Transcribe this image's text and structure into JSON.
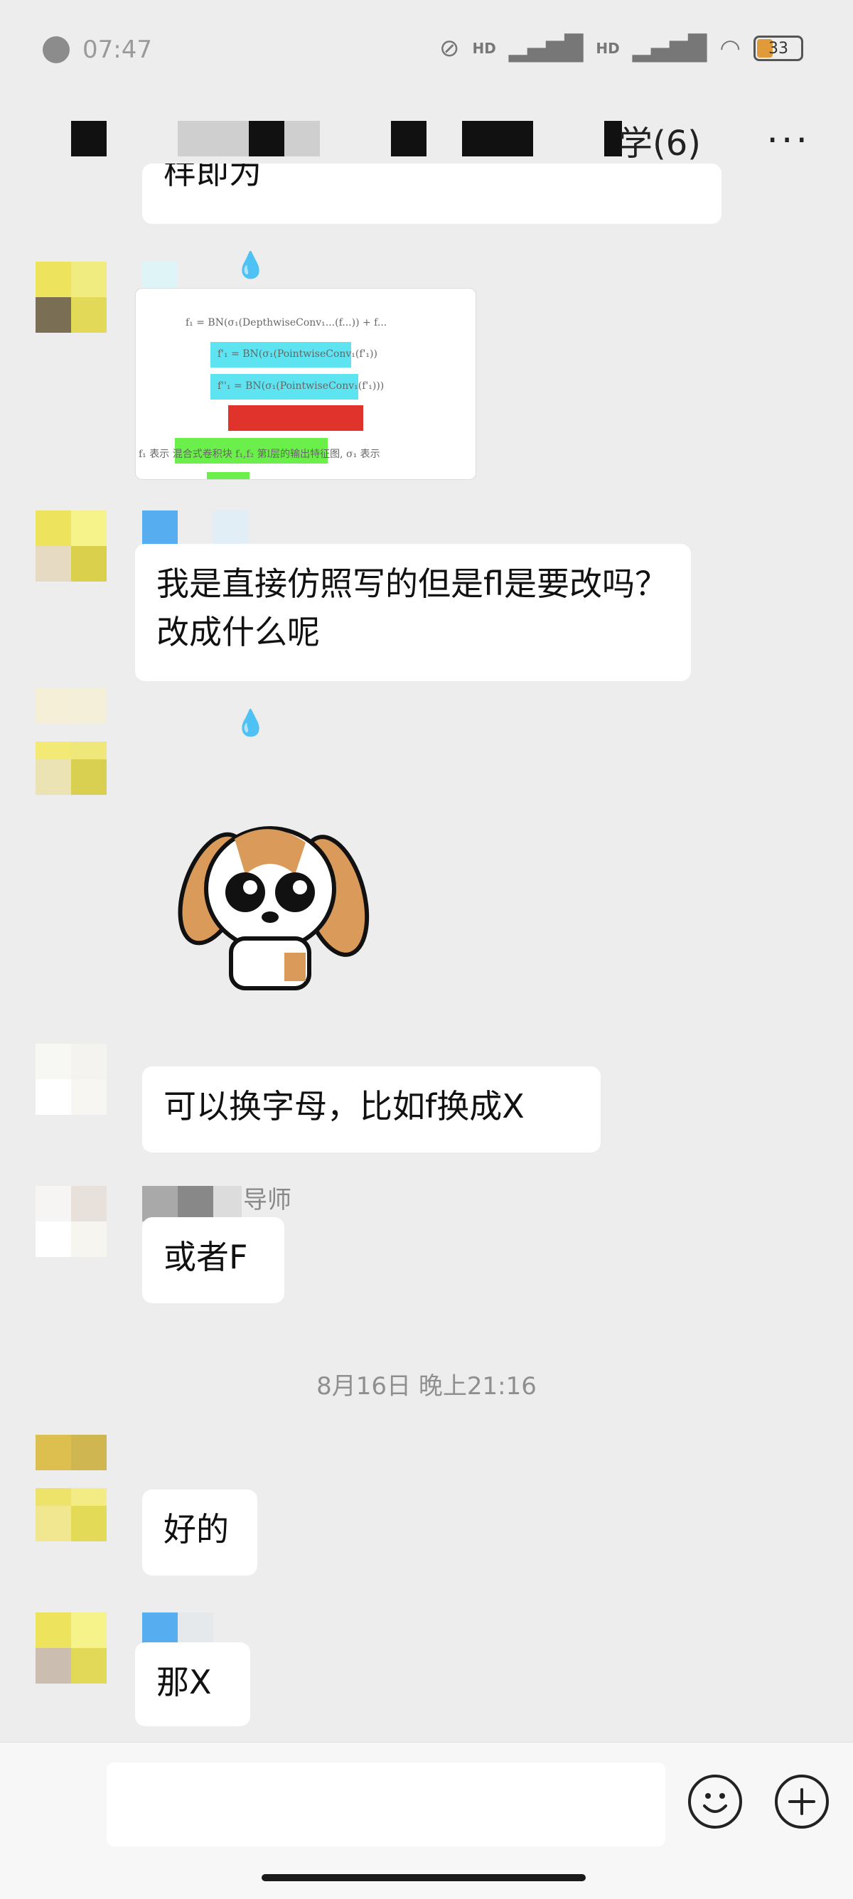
{
  "status_bar": {
    "time": "07:47",
    "battery": "33",
    "network_labels": [
      "HD",
      "HD"
    ]
  },
  "header": {
    "title_visible": "学(6)",
    "more_icon": "more-dots-icon"
  },
  "messages": [
    {
      "type": "text",
      "text": "样即为"
    },
    {
      "type": "image",
      "icon": "image-thumbnail"
    },
    {
      "type": "text",
      "text": "我是直接仿照写的但是fl是要改吗？改成什么呢"
    },
    {
      "type": "sticker",
      "icon": "puppy-sticker"
    },
    {
      "type": "text",
      "text": "可以换字母，比如f换成X"
    },
    {
      "type": "text",
      "sender": "导师",
      "text": "或者F"
    },
    {
      "type": "timestamp",
      "text": "8月16日 晚上21:16"
    },
    {
      "type": "text",
      "text": "好的"
    },
    {
      "type": "text",
      "text": "那X"
    }
  ],
  "input_bar": {
    "emoji_icon": "emoji-icon",
    "plus_icon": "plus-icon"
  },
  "colors": {
    "background": "#ededed",
    "bubble": "#ffffff",
    "text": "#111111",
    "timestamp": "#8f8f8f"
  }
}
